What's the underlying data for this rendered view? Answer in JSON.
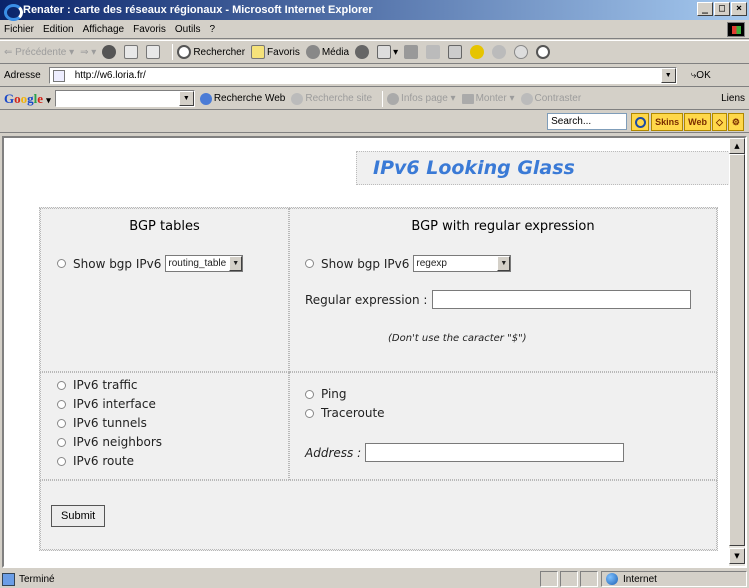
{
  "window": {
    "title": "Renater : carte des réseaux régionaux - Microsoft Internet Explorer",
    "buttons": {
      "minimize": "_",
      "maximize": "□",
      "close": "×"
    }
  },
  "menu": [
    "Fichier",
    "Edition",
    "Affichage",
    "Favoris",
    "Outils",
    "?"
  ],
  "toolbar": {
    "back": "Précédente",
    "search": "Rechercher",
    "favorites": "Favoris",
    "media": "Média"
  },
  "address": {
    "label": "Adresse",
    "url": "http://w6.loria.fr/",
    "go": "OK",
    "links": "Liens"
  },
  "google": {
    "logo": [
      "G",
      "o",
      "o",
      "g",
      "l",
      "e"
    ],
    "search_web": "Recherche Web",
    "search_site": "Recherche site",
    "page_info": "Infos page",
    "up": "Monter",
    "highlight": "Contraster"
  },
  "searchbar": {
    "placeholder": "Search...",
    "skins": "Skins",
    "web": "Web"
  },
  "page": {
    "title": "IPv6 Looking Glass",
    "bgp_tables": {
      "heading": "BGP tables",
      "option": "Show bgp IPv6",
      "select_value": "routing_table"
    },
    "bgp_regex": {
      "heading": "BGP with regular expression",
      "option": "Show bgp IPv6",
      "select_value": "regexp",
      "regex_label": "Regular expression :",
      "hint": "(Don't use the caracter \"$\")"
    },
    "ipv6_options": [
      "IPv6 traffic",
      "IPv6 interface",
      "IPv6 tunnels",
      "IPv6 neighbors",
      "IPv6 route"
    ],
    "net_tools": {
      "ping": "Ping",
      "traceroute": "Traceroute",
      "address_label": "Address :"
    },
    "submit": "Submit"
  },
  "status": {
    "text": "Terminé",
    "zone": "Internet"
  }
}
